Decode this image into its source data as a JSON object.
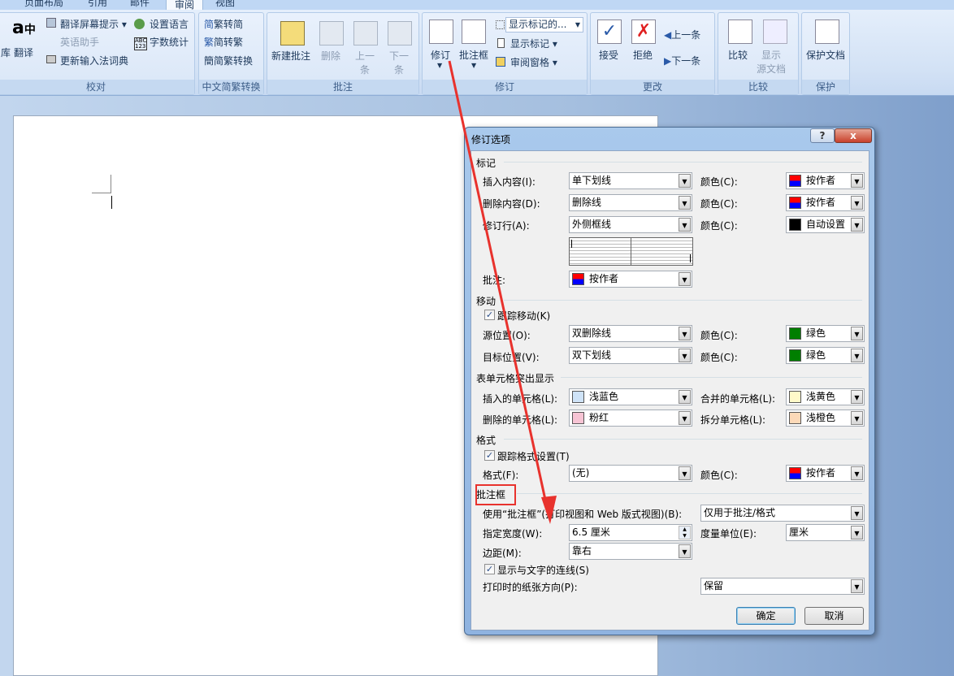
{
  "tabs": [
    "页面布局",
    "引用",
    "邮件",
    "审阅",
    "视图"
  ],
  "ribbon": {
    "proofing": {
      "label": "校对",
      "lib": "库",
      "translate": "翻译",
      "screen_tip": "翻译屏幕提示",
      "english_assist": "英语助手",
      "update_ime": "更新输入法词典",
      "set_language": "设置语言",
      "word_count": "字数统计"
    },
    "chinese": {
      "label": "中文简繁转换",
      "t2s": "繁转简",
      "s2t": "简转繁",
      "convert": "简繁转换"
    },
    "comments": {
      "label": "批注",
      "new": "新建批注",
      "delete": "删除",
      "prev": [
        "上一",
        "条"
      ],
      "next": [
        "下一",
        "条"
      ]
    },
    "tracking": {
      "label": "修订",
      "track": "修订",
      "balloons": "批注框",
      "display": "显示标记的...",
      "show_markup": "显示标记",
      "pane": "审阅窗格"
    },
    "changes": {
      "label": "更改",
      "accept": "接受",
      "reject": "拒绝",
      "prev": "上一条",
      "next": "下一条"
    },
    "compare": {
      "label": "比较",
      "compare": "比较",
      "show_source": [
        "显示",
        "源文档"
      ]
    },
    "protect": {
      "label": "保护",
      "protect_doc": "保护文档"
    }
  },
  "dialog": {
    "title": "修订选项",
    "help": "?",
    "close": "x",
    "markup": {
      "title": "标记",
      "insertions": {
        "label": "插入内容(I):",
        "value": "单下划线",
        "color_label": "颜色(C):",
        "color": "按作者"
      },
      "deletions": {
        "label": "删除内容(D):",
        "value": "删除线",
        "color_label": "颜色(C):",
        "color": "按作者"
      },
      "changed_lines": {
        "label": "修订行(A):",
        "value": "外侧框线",
        "color_label": "颜色(C):",
        "color": "自动设置"
      },
      "comments": {
        "label": "批注:",
        "color": "按作者"
      }
    },
    "moves": {
      "title": "移动",
      "track_label": "跟踪移动(K)",
      "track_checked": true,
      "from": {
        "label": "源位置(O):",
        "value": "双删除线",
        "color_label": "颜色(C):",
        "color": "绿色"
      },
      "to": {
        "label": "目标位置(V):",
        "value": "双下划线",
        "color_label": "颜色(C):",
        "color": "绿色"
      }
    },
    "cells": {
      "title": "表单元格突出显示",
      "inserted": {
        "label": "插入的单元格(L):",
        "value": "浅蓝色"
      },
      "merged": {
        "label": "合并的单元格(L):",
        "value": "浅黄色"
      },
      "deleted": {
        "label": "删除的单元格(L):",
        "value": "粉红"
      },
      "split": {
        "label": "拆分单元格(L):",
        "value": "浅橙色"
      }
    },
    "formatting": {
      "title": "格式",
      "track_label": "跟踪格式设置(T)",
      "track_checked": true,
      "format": {
        "label": "格式(F):",
        "value": "(无)",
        "color_label": "颜色(C):",
        "color": "按作者"
      }
    },
    "balloons": {
      "title": "批注框",
      "use": {
        "label": "使用“批注框”(打印视图和 Web 版式视图)(B):",
        "value": "仅用于批注/格式"
      },
      "width": {
        "label": "指定宽度(W):",
        "value": "6.5 厘米"
      },
      "unit": {
        "label": "度量单位(E):",
        "value": "厘米"
      },
      "margin": {
        "label": "边距(M):",
        "value": "靠右"
      },
      "lines_label": "显示与文字的连线(S)",
      "lines_checked": true,
      "paper": {
        "label": "打印时的纸张方向(P):",
        "value": "保留"
      }
    },
    "ok": "确定",
    "cancel": "取消"
  },
  "colors": {
    "author_top": "#ff0000",
    "author_bottom": "#0000ff",
    "auto": "#000000",
    "green": "#007f00",
    "light_blue": "#cfe3f7",
    "light_yellow": "#fff9c9",
    "pink": "#f7c4d4",
    "light_orange": "#fcd9b8",
    "annotation": "#e8322d"
  }
}
